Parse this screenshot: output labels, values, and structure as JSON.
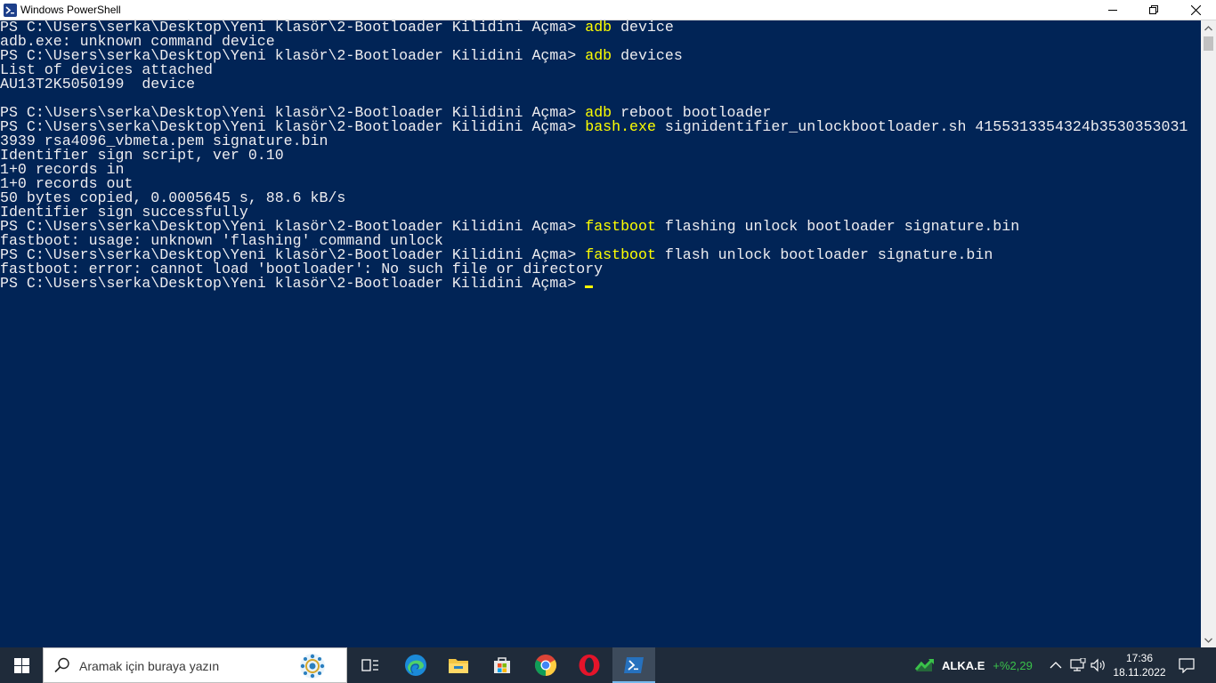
{
  "window": {
    "title": "Windows PowerShell",
    "minimize_icon": "minimize-icon",
    "maximize_icon": "restore-icon",
    "close_icon": "close-icon"
  },
  "console": {
    "lines": [
      {
        "prompt": "PS C:\\Users\\serka\\Desktop\\Yeni klasör\\2-Bootloader Kilidini Açma> ",
        "cmd": "adb",
        "args": " device"
      },
      {
        "text": "adb.exe: unknown command device"
      },
      {
        "prompt": "PS C:\\Users\\serka\\Desktop\\Yeni klasör\\2-Bootloader Kilidini Açma> ",
        "cmd": "adb",
        "args": " devices"
      },
      {
        "text": "List of devices attached"
      },
      {
        "text": "AU13T2K5050199  device"
      },
      {
        "text": ""
      },
      {
        "prompt": "PS C:\\Users\\serka\\Desktop\\Yeni klasör\\2-Bootloader Kilidini Açma> ",
        "cmd": "adb",
        "args": " reboot bootloader"
      },
      {
        "prompt": "PS C:\\Users\\serka\\Desktop\\Yeni klasör\\2-Bootloader Kilidini Açma> ",
        "cmd": "bash.exe",
        "args": " signidentifier_unlockbootloader.sh 4155313354324b3530353031"
      },
      {
        "text": "3939 rsa4096_vbmeta.pem signature.bin"
      },
      {
        "text": "Identifier sign script, ver 0.10"
      },
      {
        "text": "1+0 records in"
      },
      {
        "text": "1+0 records out"
      },
      {
        "text": "50 bytes copied, 0.0005645 s, 88.6 kB/s"
      },
      {
        "text": "Identifier sign successfully"
      },
      {
        "prompt": "PS C:\\Users\\serka\\Desktop\\Yeni klasör\\2-Bootloader Kilidini Açma> ",
        "cmd": "fastboot",
        "args": " flashing unlock bootloader signature.bin"
      },
      {
        "text": "fastboot: usage: unknown 'flashing' command unlock"
      },
      {
        "prompt": "PS C:\\Users\\serka\\Desktop\\Yeni klasör\\2-Bootloader Kilidini Açma> ",
        "cmd": "fastboot",
        "args": " flash unlock bootloader signature.bin"
      },
      {
        "text": "fastboot: error: cannot load 'bootloader': No such file or directory"
      },
      {
        "prompt": "PS C:\\Users\\serka\\Desktop\\Yeni klasör\\2-Bootloader Kilidini Açma> ",
        "cmd": "",
        "args": "",
        "cursor": true
      }
    ],
    "colors": {
      "background": "#012456",
      "text": "#eeedf0",
      "command": "#ffff00"
    }
  },
  "taskbar": {
    "start_icon": "windows-start-icon",
    "search": {
      "placeholder": "Aramak için buraya yazın",
      "icon": "search-icon"
    },
    "apps": [
      {
        "name": "task-view-icon"
      },
      {
        "name": "edge-icon"
      },
      {
        "name": "file-explorer-icon"
      },
      {
        "name": "microsoft-store-icon"
      },
      {
        "name": "chrome-icon"
      },
      {
        "name": "opera-icon"
      },
      {
        "name": "powershell-icon",
        "active": true
      }
    ],
    "stock": {
      "symbol": "ALKA.E",
      "change": "+%2,29"
    },
    "clock": {
      "time": "17:36",
      "date": "18.11.2022"
    }
  }
}
